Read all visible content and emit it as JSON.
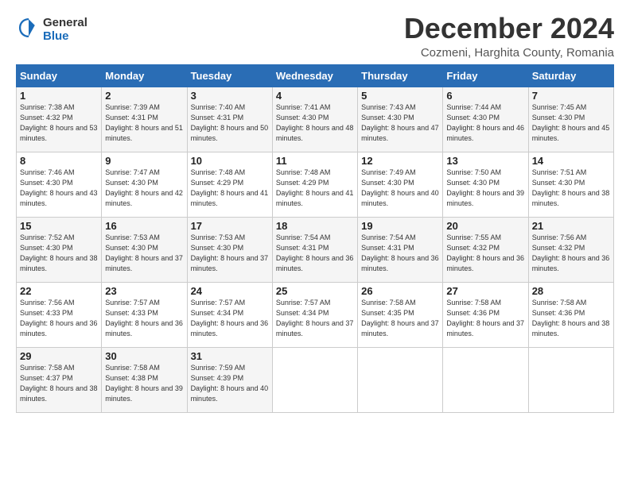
{
  "logo": {
    "line1": "General",
    "line2": "Blue"
  },
  "title": "December 2024",
  "subtitle": "Cozmeni, Harghita County, Romania",
  "days_header": [
    "Sunday",
    "Monday",
    "Tuesday",
    "Wednesday",
    "Thursday",
    "Friday",
    "Saturday"
  ],
  "weeks": [
    [
      {
        "day": "1",
        "sunrise": "7:38 AM",
        "sunset": "4:32 PM",
        "daylight": "8 hours and 53 minutes."
      },
      {
        "day": "2",
        "sunrise": "7:39 AM",
        "sunset": "4:31 PM",
        "daylight": "8 hours and 51 minutes."
      },
      {
        "day": "3",
        "sunrise": "7:40 AM",
        "sunset": "4:31 PM",
        "daylight": "8 hours and 50 minutes."
      },
      {
        "day": "4",
        "sunrise": "7:41 AM",
        "sunset": "4:30 PM",
        "daylight": "8 hours and 48 minutes."
      },
      {
        "day": "5",
        "sunrise": "7:43 AM",
        "sunset": "4:30 PM",
        "daylight": "8 hours and 47 minutes."
      },
      {
        "day": "6",
        "sunrise": "7:44 AM",
        "sunset": "4:30 PM",
        "daylight": "8 hours and 46 minutes."
      },
      {
        "day": "7",
        "sunrise": "7:45 AM",
        "sunset": "4:30 PM",
        "daylight": "8 hours and 45 minutes."
      }
    ],
    [
      {
        "day": "8",
        "sunrise": "7:46 AM",
        "sunset": "4:30 PM",
        "daylight": "8 hours and 43 minutes."
      },
      {
        "day": "9",
        "sunrise": "7:47 AM",
        "sunset": "4:30 PM",
        "daylight": "8 hours and 42 minutes."
      },
      {
        "day": "10",
        "sunrise": "7:48 AM",
        "sunset": "4:29 PM",
        "daylight": "8 hours and 41 minutes."
      },
      {
        "day": "11",
        "sunrise": "7:48 AM",
        "sunset": "4:29 PM",
        "daylight": "8 hours and 41 minutes."
      },
      {
        "day": "12",
        "sunrise": "7:49 AM",
        "sunset": "4:30 PM",
        "daylight": "8 hours and 40 minutes."
      },
      {
        "day": "13",
        "sunrise": "7:50 AM",
        "sunset": "4:30 PM",
        "daylight": "8 hours and 39 minutes."
      },
      {
        "day": "14",
        "sunrise": "7:51 AM",
        "sunset": "4:30 PM",
        "daylight": "8 hours and 38 minutes."
      }
    ],
    [
      {
        "day": "15",
        "sunrise": "7:52 AM",
        "sunset": "4:30 PM",
        "daylight": "8 hours and 38 minutes."
      },
      {
        "day": "16",
        "sunrise": "7:53 AM",
        "sunset": "4:30 PM",
        "daylight": "8 hours and 37 minutes."
      },
      {
        "day": "17",
        "sunrise": "7:53 AM",
        "sunset": "4:30 PM",
        "daylight": "8 hours and 37 minutes."
      },
      {
        "day": "18",
        "sunrise": "7:54 AM",
        "sunset": "4:31 PM",
        "daylight": "8 hours and 36 minutes."
      },
      {
        "day": "19",
        "sunrise": "7:54 AM",
        "sunset": "4:31 PM",
        "daylight": "8 hours and 36 minutes."
      },
      {
        "day": "20",
        "sunrise": "7:55 AM",
        "sunset": "4:32 PM",
        "daylight": "8 hours and 36 minutes."
      },
      {
        "day": "21",
        "sunrise": "7:56 AM",
        "sunset": "4:32 PM",
        "daylight": "8 hours and 36 minutes."
      }
    ],
    [
      {
        "day": "22",
        "sunrise": "7:56 AM",
        "sunset": "4:33 PM",
        "daylight": "8 hours and 36 minutes."
      },
      {
        "day": "23",
        "sunrise": "7:57 AM",
        "sunset": "4:33 PM",
        "daylight": "8 hours and 36 minutes."
      },
      {
        "day": "24",
        "sunrise": "7:57 AM",
        "sunset": "4:34 PM",
        "daylight": "8 hours and 36 minutes."
      },
      {
        "day": "25",
        "sunrise": "7:57 AM",
        "sunset": "4:34 PM",
        "daylight": "8 hours and 37 minutes."
      },
      {
        "day": "26",
        "sunrise": "7:58 AM",
        "sunset": "4:35 PM",
        "daylight": "8 hours and 37 minutes."
      },
      {
        "day": "27",
        "sunrise": "7:58 AM",
        "sunset": "4:36 PM",
        "daylight": "8 hours and 37 minutes."
      },
      {
        "day": "28",
        "sunrise": "7:58 AM",
        "sunset": "4:36 PM",
        "daylight": "8 hours and 38 minutes."
      }
    ],
    [
      {
        "day": "29",
        "sunrise": "7:58 AM",
        "sunset": "4:37 PM",
        "daylight": "8 hours and 38 minutes."
      },
      {
        "day": "30",
        "sunrise": "7:58 AM",
        "sunset": "4:38 PM",
        "daylight": "8 hours and 39 minutes."
      },
      {
        "day": "31",
        "sunrise": "7:59 AM",
        "sunset": "4:39 PM",
        "daylight": "8 hours and 40 minutes."
      },
      null,
      null,
      null,
      null
    ]
  ]
}
